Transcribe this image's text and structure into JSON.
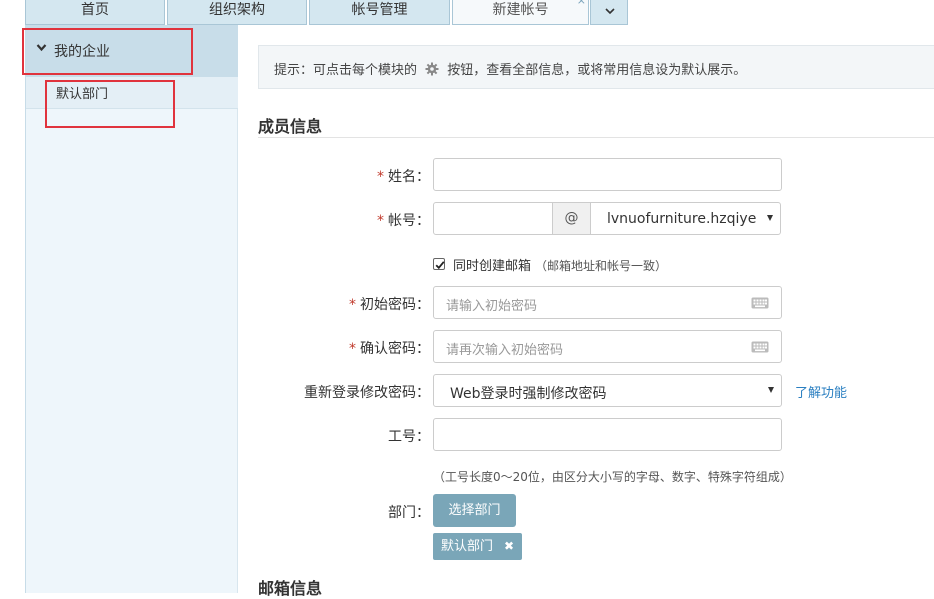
{
  "tabs": [
    {
      "label": "首页"
    },
    {
      "label": "组织架构"
    },
    {
      "label": "帐号管理"
    },
    {
      "label": "新建帐号",
      "close": "×"
    }
  ],
  "sidebar": {
    "group_label": "我的企业",
    "items": [
      {
        "label": "默认部门"
      }
    ]
  },
  "hint": {
    "prefix": "提示：可点击每个模块的",
    "suffix": "按钮，查看全部信息，或将常用信息设为默认展示。"
  },
  "member_section": {
    "title": "成员信息"
  },
  "form": {
    "required_mark": "*",
    "name_label": "姓名：",
    "account_label": "帐号：",
    "at_symbol": "@",
    "domain_value": "lvnuofurniture.hzqiye",
    "create_mailbox_label": "同时创建邮箱",
    "create_mailbox_note": "（邮箱地址和帐号一致）",
    "create_mailbox_checked": true,
    "init_password_label": "初始密码：",
    "init_password_placeholder": "请输入初始密码",
    "confirm_password_label": "确认密码：",
    "confirm_password_placeholder": "请再次输入初始密码",
    "relogin_label": "重新登录修改密码：",
    "relogin_value": "Web登录时强制修改密码",
    "learn_link": "了解功能",
    "employee_id_label": "工号：",
    "employee_id_note": "（工号长度0～20位，由区分大小写的字母、数字、特殊字符组成）",
    "department_label": "部门：",
    "select_department_button": "选择部门",
    "department_tag": "默认部门",
    "tag_remove": "✖"
  },
  "mailbox_section": {
    "title": "邮箱信息"
  },
  "colors": {
    "accent_button": "#7aa6b8",
    "link": "#2a7fc1",
    "required": "#c0392b",
    "highlight_box": "#e0333d"
  }
}
